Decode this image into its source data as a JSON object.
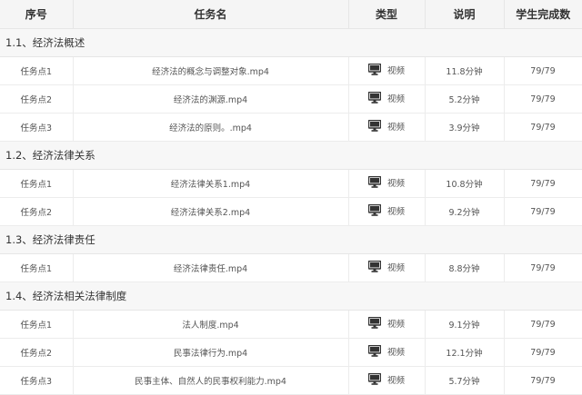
{
  "headers": {
    "seq": "序号",
    "name": "任务名",
    "type": "类型",
    "desc": "说明",
    "completion": "学生完成数"
  },
  "sections": [
    {
      "title": "1.1、经济法概述",
      "tasks": [
        {
          "seq": "任务点1",
          "name": "经济法的概念与调整对象.mp4",
          "type": "视频",
          "icon": "monitor-icon",
          "desc": "11.8分钟",
          "completion": "79/79"
        },
        {
          "seq": "任务点2",
          "name": "经济法的渊源.mp4",
          "type": "视频",
          "icon": "monitor-icon",
          "desc": "5.2分钟",
          "completion": "79/79"
        },
        {
          "seq": "任务点3",
          "name": "经济法的原则。.mp4",
          "type": "视频",
          "icon": "monitor-icon",
          "desc": "3.9分钟",
          "completion": "79/79"
        }
      ]
    },
    {
      "title": "1.2、经济法律关系",
      "tasks": [
        {
          "seq": "任务点1",
          "name": "经济法律关系1.mp4",
          "type": "视频",
          "icon": "monitor-icon",
          "desc": "10.8分钟",
          "completion": "79/79"
        },
        {
          "seq": "任务点2",
          "name": "经济法律关系2.mp4",
          "type": "视频",
          "icon": "monitor-icon",
          "desc": "9.2分钟",
          "completion": "79/79"
        }
      ]
    },
    {
      "title": "1.3、经济法律责任",
      "tasks": [
        {
          "seq": "任务点1",
          "name": "经济法律责任.mp4",
          "type": "视频",
          "icon": "monitor-icon",
          "desc": "8.8分钟",
          "completion": "79/79"
        }
      ]
    },
    {
      "title": "1.4、经济法相关法律制度",
      "tasks": [
        {
          "seq": "任务点1",
          "name": "法人制度.mp4",
          "type": "视频",
          "icon": "monitor-icon",
          "desc": "9.1分钟",
          "completion": "79/79"
        },
        {
          "seq": "任务点2",
          "name": "民事法律行为.mp4",
          "type": "视频",
          "icon": "monitor-icon",
          "desc": "12.1分钟",
          "completion": "79/79"
        },
        {
          "seq": "任务点3",
          "name": "民事主体、自然人的民事权利能力.mp4",
          "type": "视频",
          "icon": "monitor-icon",
          "desc": "5.7分钟",
          "completion": "79/79"
        }
      ]
    }
  ]
}
